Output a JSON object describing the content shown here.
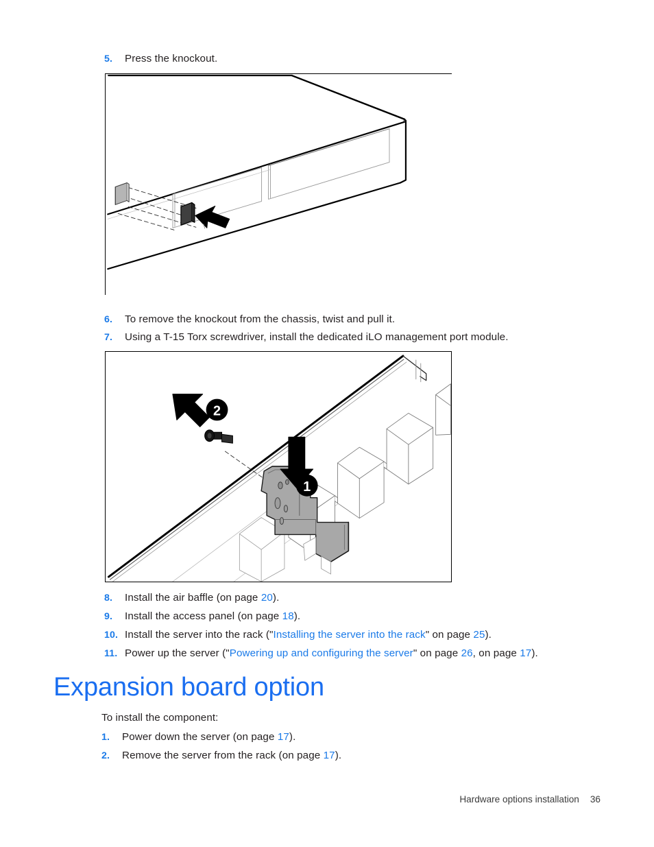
{
  "document": {
    "footer_section": "Hardware options installation",
    "footer_page": "36"
  },
  "steps_top": [
    {
      "number": "5.",
      "text": "Press the knockout."
    }
  ],
  "steps_middle": [
    {
      "number": "6.",
      "text": "To remove the knockout from the chassis, twist and pull it."
    },
    {
      "number": "7.",
      "text": "Using a T-15 Torx screwdriver, install the dedicated iLO management port module."
    }
  ],
  "steps_bottom": [
    {
      "number": "8.",
      "prefix": "Install the air baffle (on page ",
      "page_ref": "20",
      "suffix": ")."
    },
    {
      "number": "9.",
      "prefix": "Install the access panel (on page ",
      "page_ref": "18",
      "suffix": ")."
    },
    {
      "number": "10.",
      "prefix": "Install the server into the rack (\"",
      "link": "Installing the server into the rack",
      "mid": "\" on page ",
      "page_ref": "25",
      "suffix": ")."
    },
    {
      "number": "11.",
      "prefix": "Power up the server (\"",
      "link": "Powering up and configuring the server",
      "mid": "\" on page ",
      "page_ref": "26",
      "mid2": ", on page ",
      "page_ref2": "17",
      "suffix": ")."
    }
  ],
  "section": {
    "heading": "Expansion board option",
    "intro": "To install the component:",
    "steps": [
      {
        "number": "1.",
        "prefix": "Power down the server (on page ",
        "page_ref": "17",
        "suffix": ")."
      },
      {
        "number": "2.",
        "prefix": "Remove the server from the rack (on page ",
        "page_ref": "17",
        "suffix": ")."
      }
    ]
  },
  "figures": {
    "knockout": {
      "name": "Server chassis knockout removal illustration",
      "callouts": []
    },
    "ilo_module": {
      "name": "Dedicated iLO management port module installation illustration",
      "callouts": [
        "1",
        "2"
      ]
    }
  },
  "colors": {
    "link_blue": "#1a7ae8",
    "heading_blue": "#1a6ef0",
    "body_black": "#231f20",
    "part_gray": "#a8a8a8",
    "knockout_dark": "#3f3f3f"
  }
}
